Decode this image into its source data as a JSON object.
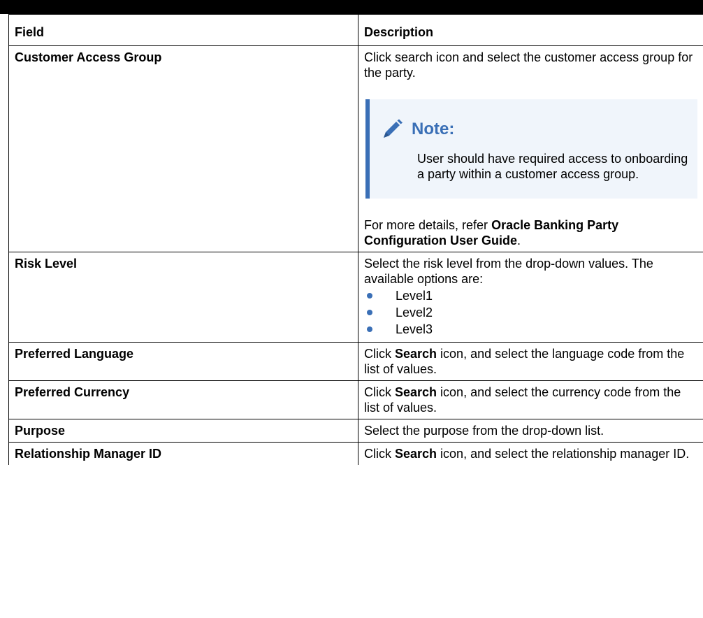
{
  "table": {
    "header": {
      "field": "Field",
      "description": "Description"
    },
    "rows": {
      "cag": {
        "field": "Customer Access Group",
        "desc_1": "Click search icon and select the customer access group for the party.",
        "note_title": "Note:",
        "note_text": "User should have required access to onboarding a party within a customer access group.",
        "more_prefix": "For more details, refer ",
        "more_bold": "Oracle Banking Party Configuration User Guide",
        "more_suffix": "."
      },
      "risk": {
        "field": "Risk Level",
        "desc": "Select the risk level from the drop-down values. The available options are:",
        "options": [
          "Level1",
          "Level2",
          "Level3"
        ]
      },
      "lang": {
        "field": "Preferred Language",
        "desc_pre": "Click ",
        "desc_bold": "Search",
        "desc_post": " icon, and select the language code from the list of values."
      },
      "curr": {
        "field": "Preferred Currency",
        "desc_pre": "Click ",
        "desc_bold": "Search",
        "desc_post": " icon, and select the currency code from the list of values."
      },
      "purpose": {
        "field": "Purpose",
        "desc": "Select the purpose from the drop-down list."
      },
      "rm": {
        "field": "Relationship Manager ID",
        "desc_pre": "Click ",
        "desc_bold": "Search",
        "desc_post": " icon, and select the relationship manager ID."
      }
    }
  },
  "colors": {
    "note_accent": "#3a6fb6",
    "note_background": "#f0f5fb",
    "bullet": "#3a6fb6"
  },
  "icons": {
    "note": "pencil-icon",
    "list_bullet": "bullet-dot"
  }
}
